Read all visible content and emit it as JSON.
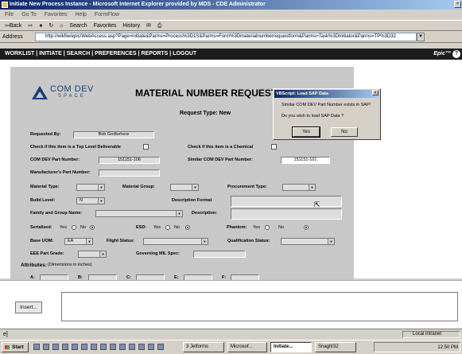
{
  "window": {
    "title": "Initiate New Process Instance - Microsoft Internet Explorer provided by MDS - CDE Administrator"
  },
  "menu": [
    "File",
    "Go To",
    "Favorites",
    "Help",
    "FormFlow"
  ],
  "toolbar": {
    "back": "⇦Back",
    "forward": "⇨",
    "search": "Search",
    "favorites": "Favorites",
    "history": "History"
  },
  "address": {
    "label": "Address",
    "url": "http://wikfiw/epic/WebAccess.asp?Page=initiate&Parms=Process%3D1S&Parms=Form%3Dmaterialnumberrequestform&Parms=Task%3DInitiator&Parms=TP%3D32"
  },
  "nav": {
    "items": [
      "WORKLIST",
      "INITIATE",
      "SEARCH",
      "PREFERENCES",
      "REPORTS",
      "LOGOUT"
    ],
    "brand": "Epic™",
    "help": "?"
  },
  "logo": {
    "main": "COM DEV",
    "sub": "SPACE"
  },
  "form": {
    "title": "MATERIAL NUMBER REQUEST",
    "request_type": "Request Type:  New",
    "requested_by_label": "Requested By:",
    "requested_by": "Bob Godbehere",
    "top_level_label": "Check if this item is a Top Level Deliverable",
    "chemical_label": "Check if this item is a Chemical",
    "comdev_pn_label": "COM DEV Part Number:",
    "comdev_pn": "151151-106",
    "similar_pn_label": "Similar COM DEV Part Number:",
    "similar_pn": "151151-101",
    "mfr_pn_label": "Manufacturer's Part Number:",
    "material_type_label": "Material Type:",
    "material_group_label": "Material Group:",
    "procurement_type_label": "Procurement Type:",
    "build_level_label": "Build Level:",
    "build_level": "N",
    "description_format_label": "Description Format",
    "family_label": "Family and Group Name:",
    "description_label": "Description:",
    "serialized_label": "Serialized:",
    "esd_label": "ESD:",
    "phantom_label": "Phantom:",
    "yes": "Yes",
    "no": "No",
    "base_uom_label": "Base UOM:",
    "base_uom": "EA",
    "flight_status_label": "Flight Status:",
    "qualification_label": "Qualification Status:",
    "eee_label": "EEE Part Grade:",
    "governing_label": "Governing MIL Spec:",
    "attributes_label": "Attributes:",
    "attributes_note": "(Dimensions in inches)",
    "attr_a": "A:",
    "attr_b": "B:",
    "attr_c": "C:",
    "attr_e": "E:",
    "attr_f": "F:"
  },
  "dialog": {
    "title": "VBScript: Load SAP Data",
    "close": "X",
    "message1": "Similar COM DEV Part Number exists in SAP!",
    "message2": "Do you wish to load SAP Data ?",
    "yes": "Yes",
    "no": "No"
  },
  "bottom": {
    "insert": "Insert..."
  },
  "status": {
    "left": "e]",
    "zone": "Local intranet"
  },
  "taskbar": {
    "start": "Start",
    "buttons": [
      "3 Jetforms",
      "Microsof...",
      "Initiate...",
      "SnagIt/32"
    ],
    "clock": "12:50 PM"
  },
  "colors": {
    "navbar": "#1c1c1c",
    "titlebar": "#0a246a",
    "form_bg": "#c8c8c8",
    "logo": "#1a3d7a"
  }
}
